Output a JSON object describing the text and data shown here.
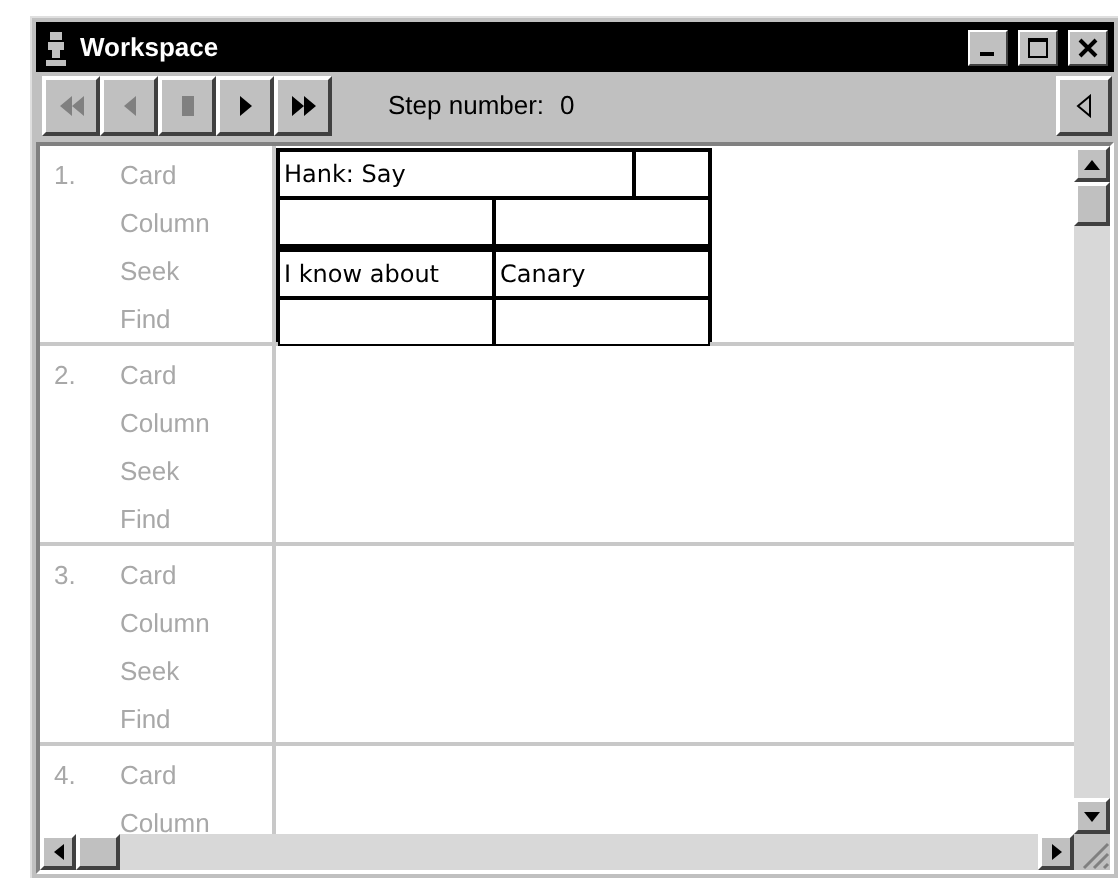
{
  "window": {
    "title": "Workspace"
  },
  "toolbar": {
    "buttons": [
      {
        "kind": "rewind",
        "disabled": true
      },
      {
        "kind": "back",
        "disabled": true
      },
      {
        "kind": "stop",
        "disabled": true
      },
      {
        "kind": "play",
        "disabled": false
      },
      {
        "kind": "fast_forward",
        "disabled": false
      }
    ],
    "step_label": "Step number:",
    "step_value": "0"
  },
  "steps": [
    {
      "number": "1.",
      "labels": [
        "Card",
        "Column",
        "Seek",
        "Find"
      ],
      "grid": {
        "card": "Hank: Say",
        "seek": [
          "I know about",
          "Canary"
        ]
      }
    },
    {
      "number": "2.",
      "labels": [
        "Card",
        "Column",
        "Seek",
        "Find"
      ]
    },
    {
      "number": "3.",
      "labels": [
        "Card",
        "Column",
        "Seek",
        "Find"
      ]
    },
    {
      "number": "4.",
      "labels": [
        "Card",
        "Column"
      ]
    }
  ]
}
